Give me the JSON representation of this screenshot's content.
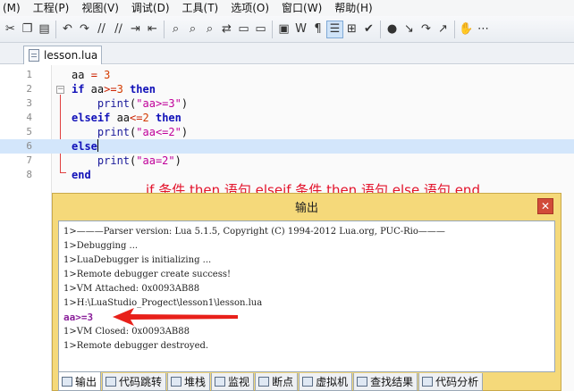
{
  "menu": [
    "(M)",
    "工程(P)",
    "视图(V)",
    "调试(D)",
    "工具(T)",
    "选项(O)",
    "窗口(W)",
    "帮助(H)"
  ],
  "toolbar": {
    "groups": [
      [
        "cut-icon",
        "copy-icon",
        "paste-icon"
      ],
      [
        "undo-icon",
        "redo-icon",
        "comment-icon",
        "uncomment-icon",
        "indent-icon",
        "outdent-icon"
      ],
      [
        "find-icon",
        "find-next-icon",
        "find-prev-icon",
        "replace-icon",
        "bookmark-icon",
        "bookmark-next-icon"
      ],
      [
        "window-icon",
        "word-wrap-icon",
        "whitespace-icon",
        "line-numbers-icon",
        "fold-icon",
        "check-icon"
      ],
      [
        "breakpoint-icon",
        "step-into-icon",
        "step-over-icon",
        "step-out-icon"
      ],
      [
        "hand-icon",
        "more-icon"
      ]
    ],
    "glyphs": {
      "cut-icon": "✂",
      "copy-icon": "❐",
      "paste-icon": "▤",
      "undo-icon": "↶",
      "redo-icon": "↷",
      "comment-icon": "//",
      "uncomment-icon": "/∕",
      "indent-icon": "⇥",
      "outdent-icon": "⇤",
      "find-icon": "⌕",
      "find-next-icon": "⌕",
      "find-prev-icon": "⌕",
      "replace-icon": "⇄",
      "bookmark-icon": "▭",
      "bookmark-next-icon": "▭",
      "window-icon": "▣",
      "word-wrap-icon": "W",
      "whitespace-icon": "¶",
      "line-numbers-icon": "☰",
      "fold-icon": "⊞",
      "check-icon": "✔",
      "breakpoint-icon": "●",
      "step-into-icon": "↘",
      "step-over-icon": "↷",
      "step-out-icon": "↗",
      "hand-icon": "✋",
      "more-icon": "⋯"
    },
    "active": "line-numbers-icon"
  },
  "tab": {
    "label": "lesson.lua"
  },
  "editor": {
    "lines": [
      {
        "num": "1",
        "tokens": [
          [
            "",
            "aa "
          ],
          [
            "op",
            "="
          ],
          [
            "",
            " "
          ],
          [
            "num",
            "3"
          ]
        ]
      },
      {
        "num": "2",
        "tokens": [
          [
            "kw",
            "if"
          ],
          [
            "",
            " aa"
          ],
          [
            "op",
            ">="
          ],
          [
            "num",
            "3"
          ],
          [
            "",
            " "
          ],
          [
            "kw",
            "then"
          ]
        ]
      },
      {
        "num": "3",
        "tokens": [
          [
            "",
            "    "
          ],
          [
            "fn",
            "print"
          ],
          [
            "",
            "("
          ],
          [
            "str",
            "\"aa>=3\""
          ],
          [
            "",
            ")"
          ]
        ]
      },
      {
        "num": "4",
        "tokens": [
          [
            "kw",
            "elseif"
          ],
          [
            "",
            " aa"
          ],
          [
            "op",
            "<="
          ],
          [
            "num",
            "2"
          ],
          [
            "",
            " "
          ],
          [
            "kw",
            "then"
          ]
        ]
      },
      {
        "num": "5",
        "tokens": [
          [
            "",
            "    "
          ],
          [
            "fn",
            "print"
          ],
          [
            "",
            "("
          ],
          [
            "str",
            "\"aa<=2\""
          ],
          [
            "",
            ")"
          ]
        ]
      },
      {
        "num": "6",
        "tokens": [
          [
            "kw",
            "else"
          ]
        ]
      },
      {
        "num": "7",
        "tokens": [
          [
            "",
            "    "
          ],
          [
            "fn",
            "print"
          ],
          [
            "",
            "("
          ],
          [
            "str",
            "\"aa=2\""
          ],
          [
            "",
            ")"
          ]
        ]
      },
      {
        "num": "8",
        "tokens": [
          [
            "kw",
            "end"
          ]
        ]
      }
    ],
    "current_line": "6"
  },
  "annotation": "if 条件 then 语句 elseif 条件 then 语句 else 语句 end",
  "output": {
    "title": "输出",
    "close": "✕",
    "lines": [
      "1>———Parser version: Lua 5.1.5, Copyright (C) 1994-2012 Lua.org, PUC-Rio———",
      "1>Debugging ...",
      "1>LuaDebugger is initializing ...",
      "1>Remote debugger create success!",
      "1>VM Attached: 0x0093AB88",
      "1>H:\\LuaStudio_Progect\\lesson1\\lesson.lua",
      "aa>=3",
      "1>VM Closed: 0x0093AB88",
      "1>Remote debugger destroyed."
    ],
    "tabs": [
      "输出",
      "代码跳转",
      "堆栈",
      "监视",
      "断点",
      "虚拟机",
      "查找结果",
      "代码分析"
    ]
  }
}
